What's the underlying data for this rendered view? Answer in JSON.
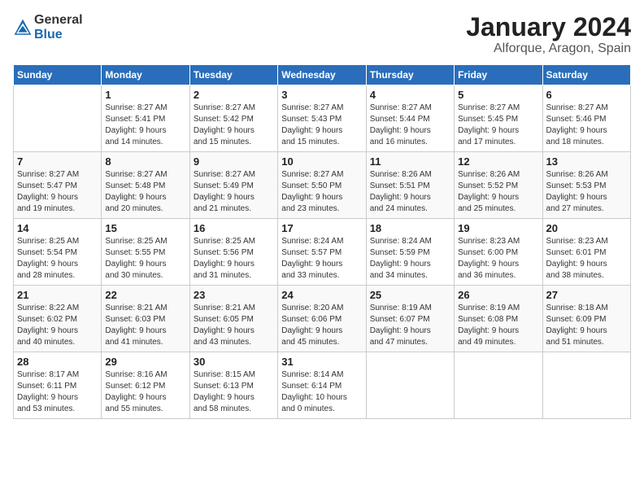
{
  "logo": {
    "general": "General",
    "blue": "Blue"
  },
  "title": "January 2024",
  "subtitle": "Alforque, Aragon, Spain",
  "days": [
    "Sunday",
    "Monday",
    "Tuesday",
    "Wednesday",
    "Thursday",
    "Friday",
    "Saturday"
  ],
  "weeks": [
    [
      {
        "date": "",
        "info": ""
      },
      {
        "date": "1",
        "info": "Sunrise: 8:27 AM\nSunset: 5:41 PM\nDaylight: 9 hours\nand 14 minutes."
      },
      {
        "date": "2",
        "info": "Sunrise: 8:27 AM\nSunset: 5:42 PM\nDaylight: 9 hours\nand 15 minutes."
      },
      {
        "date": "3",
        "info": "Sunrise: 8:27 AM\nSunset: 5:43 PM\nDaylight: 9 hours\nand 15 minutes."
      },
      {
        "date": "4",
        "info": "Sunrise: 8:27 AM\nSunset: 5:44 PM\nDaylight: 9 hours\nand 16 minutes."
      },
      {
        "date": "5",
        "info": "Sunrise: 8:27 AM\nSunset: 5:45 PM\nDaylight: 9 hours\nand 17 minutes."
      },
      {
        "date": "6",
        "info": "Sunrise: 8:27 AM\nSunset: 5:46 PM\nDaylight: 9 hours\nand 18 minutes."
      }
    ],
    [
      {
        "date": "7",
        "info": "Sunrise: 8:27 AM\nSunset: 5:47 PM\nDaylight: 9 hours\nand 19 minutes."
      },
      {
        "date": "8",
        "info": "Sunrise: 8:27 AM\nSunset: 5:48 PM\nDaylight: 9 hours\nand 20 minutes."
      },
      {
        "date": "9",
        "info": "Sunrise: 8:27 AM\nSunset: 5:49 PM\nDaylight: 9 hours\nand 21 minutes."
      },
      {
        "date": "10",
        "info": "Sunrise: 8:27 AM\nSunset: 5:50 PM\nDaylight: 9 hours\nand 23 minutes."
      },
      {
        "date": "11",
        "info": "Sunrise: 8:26 AM\nSunset: 5:51 PM\nDaylight: 9 hours\nand 24 minutes."
      },
      {
        "date": "12",
        "info": "Sunrise: 8:26 AM\nSunset: 5:52 PM\nDaylight: 9 hours\nand 25 minutes."
      },
      {
        "date": "13",
        "info": "Sunrise: 8:26 AM\nSunset: 5:53 PM\nDaylight: 9 hours\nand 27 minutes."
      }
    ],
    [
      {
        "date": "14",
        "info": "Sunrise: 8:25 AM\nSunset: 5:54 PM\nDaylight: 9 hours\nand 28 minutes."
      },
      {
        "date": "15",
        "info": "Sunrise: 8:25 AM\nSunset: 5:55 PM\nDaylight: 9 hours\nand 30 minutes."
      },
      {
        "date": "16",
        "info": "Sunrise: 8:25 AM\nSunset: 5:56 PM\nDaylight: 9 hours\nand 31 minutes."
      },
      {
        "date": "17",
        "info": "Sunrise: 8:24 AM\nSunset: 5:57 PM\nDaylight: 9 hours\nand 33 minutes."
      },
      {
        "date": "18",
        "info": "Sunrise: 8:24 AM\nSunset: 5:59 PM\nDaylight: 9 hours\nand 34 minutes."
      },
      {
        "date": "19",
        "info": "Sunrise: 8:23 AM\nSunset: 6:00 PM\nDaylight: 9 hours\nand 36 minutes."
      },
      {
        "date": "20",
        "info": "Sunrise: 8:23 AM\nSunset: 6:01 PM\nDaylight: 9 hours\nand 38 minutes."
      }
    ],
    [
      {
        "date": "21",
        "info": "Sunrise: 8:22 AM\nSunset: 6:02 PM\nDaylight: 9 hours\nand 40 minutes."
      },
      {
        "date": "22",
        "info": "Sunrise: 8:21 AM\nSunset: 6:03 PM\nDaylight: 9 hours\nand 41 minutes."
      },
      {
        "date": "23",
        "info": "Sunrise: 8:21 AM\nSunset: 6:05 PM\nDaylight: 9 hours\nand 43 minutes."
      },
      {
        "date": "24",
        "info": "Sunrise: 8:20 AM\nSunset: 6:06 PM\nDaylight: 9 hours\nand 45 minutes."
      },
      {
        "date": "25",
        "info": "Sunrise: 8:19 AM\nSunset: 6:07 PM\nDaylight: 9 hours\nand 47 minutes."
      },
      {
        "date": "26",
        "info": "Sunrise: 8:19 AM\nSunset: 6:08 PM\nDaylight: 9 hours\nand 49 minutes."
      },
      {
        "date": "27",
        "info": "Sunrise: 8:18 AM\nSunset: 6:09 PM\nDaylight: 9 hours\nand 51 minutes."
      }
    ],
    [
      {
        "date": "28",
        "info": "Sunrise: 8:17 AM\nSunset: 6:11 PM\nDaylight: 9 hours\nand 53 minutes."
      },
      {
        "date": "29",
        "info": "Sunrise: 8:16 AM\nSunset: 6:12 PM\nDaylight: 9 hours\nand 55 minutes."
      },
      {
        "date": "30",
        "info": "Sunrise: 8:15 AM\nSunset: 6:13 PM\nDaylight: 9 hours\nand 58 minutes."
      },
      {
        "date": "31",
        "info": "Sunrise: 8:14 AM\nSunset: 6:14 PM\nDaylight: 10 hours\nand 0 minutes."
      },
      {
        "date": "",
        "info": ""
      },
      {
        "date": "",
        "info": ""
      },
      {
        "date": "",
        "info": ""
      }
    ]
  ]
}
